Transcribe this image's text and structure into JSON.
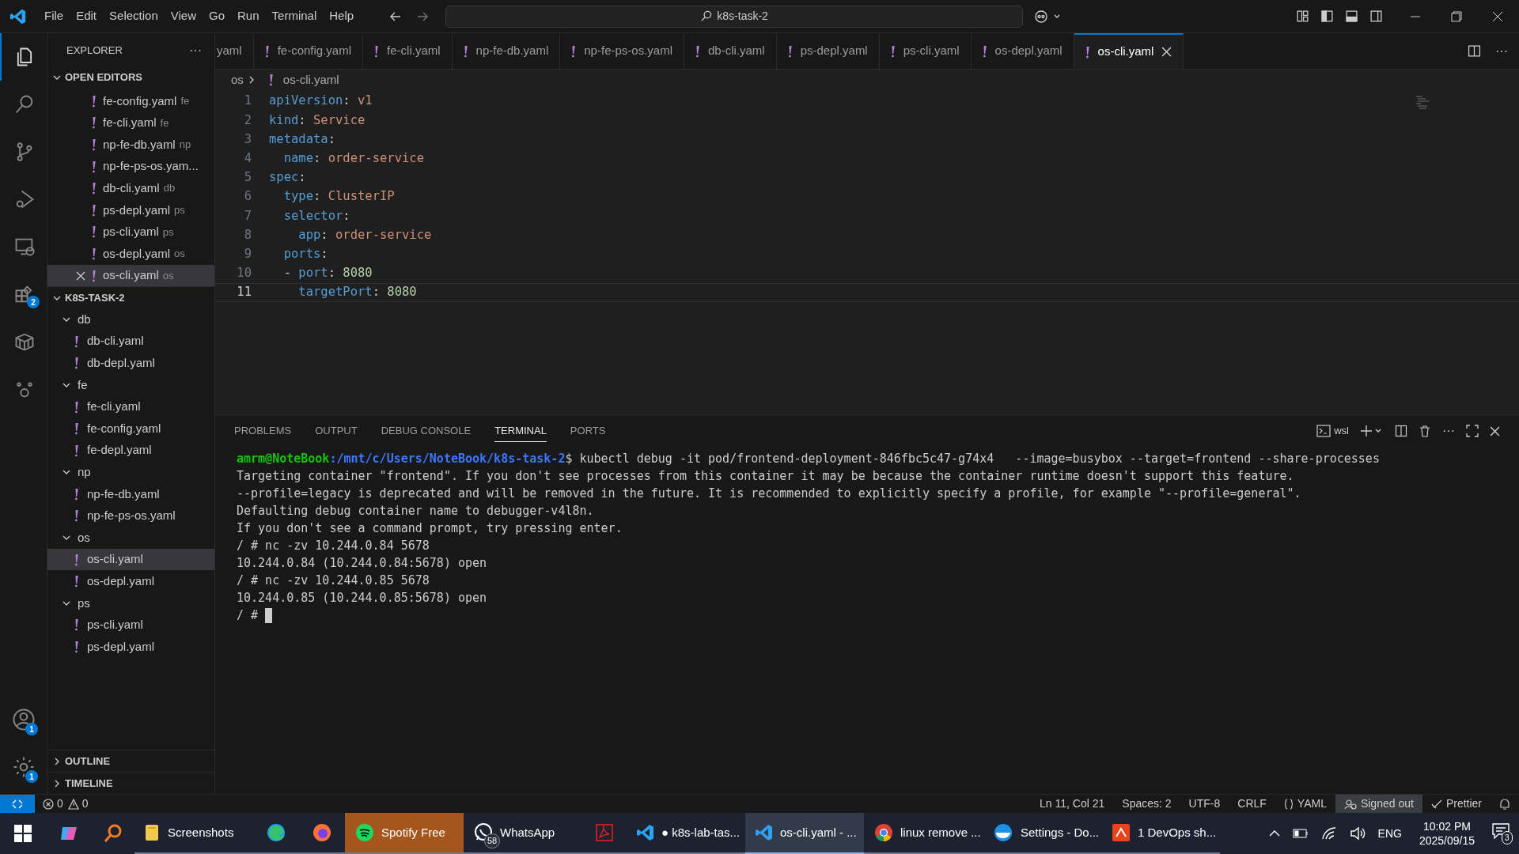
{
  "title_bar": {
    "menu": [
      "File",
      "Edit",
      "Selection",
      "View",
      "Go",
      "Run",
      "Terminal",
      "Help"
    ],
    "search": "k8s-task-2"
  },
  "activity_bar": [
    {
      "kind": "explorer",
      "selected": true
    },
    {
      "kind": "search",
      "selected": false
    },
    {
      "kind": "source-control",
      "selected": false
    },
    {
      "kind": "run",
      "selected": false
    },
    {
      "kind": "remote",
      "selected": false
    },
    {
      "kind": "extensions",
      "selected": false,
      "badge": "2"
    },
    {
      "kind": "containers",
      "selected": false
    },
    {
      "kind": "face",
      "selected": false
    }
  ],
  "activity_bottom": [
    {
      "kind": "account",
      "badge": "1"
    },
    {
      "kind": "settings",
      "badge": "1"
    }
  ],
  "sidebar": {
    "title": "EXPLORER",
    "more": "···",
    "open_editors": {
      "title": "OPEN EDITORS",
      "items": [
        {
          "name": "fe-config.yaml",
          "folder": "fe",
          "selected": false
        },
        {
          "name": "fe-cli.yaml",
          "folder": "fe",
          "selected": false
        },
        {
          "name": "np-fe-db.yaml",
          "folder": "np",
          "selected": false
        },
        {
          "name": "np-fe-ps-os.yam...",
          "selected": false
        },
        {
          "name": "db-cli.yaml",
          "folder": "db",
          "selected": false
        },
        {
          "name": "ps-depl.yaml",
          "folder": "ps",
          "selected": false
        },
        {
          "name": "ps-cli.yaml",
          "folder": "ps",
          "selected": false
        },
        {
          "name": "os-depl.yaml",
          "folder": "os",
          "selected": false
        },
        {
          "name": "os-cli.yaml",
          "folder": "os",
          "selected": true
        }
      ]
    },
    "project": {
      "title": "K8S-TASK-2",
      "tree": [
        {
          "name": "db",
          "expanded": true,
          "children": [
            {
              "name": "db-cli.yaml",
              "selected": false
            },
            {
              "name": "db-depl.yaml",
              "selected": false
            }
          ]
        },
        {
          "name": "fe",
          "expanded": true,
          "children": [
            {
              "name": "fe-cli.yaml",
              "selected": false
            },
            {
              "name": "fe-config.yaml",
              "selected": false
            },
            {
              "name": "fe-depl.yaml",
              "selected": false
            }
          ]
        },
        {
          "name": "np",
          "expanded": true,
          "children": [
            {
              "name": "np-fe-db.yaml",
              "selected": false
            },
            {
              "name": "np-fe-ps-os.yaml",
              "selected": false
            }
          ]
        },
        {
          "name": "os",
          "expanded": true,
          "children": [
            {
              "name": "os-cli.yaml",
              "selected": true
            },
            {
              "name": "os-depl.yaml",
              "selected": false
            }
          ]
        },
        {
          "name": "ps",
          "expanded": true,
          "children": [
            {
              "name": "ps-cli.yaml",
              "selected": false
            },
            {
              "name": "ps-depl.yaml",
              "selected": false
            }
          ]
        }
      ]
    },
    "sections": [
      {
        "title": "OUTLINE",
        "expanded": false
      },
      {
        "title": "TIMELINE",
        "expanded": false
      }
    ]
  },
  "tabs": [
    {
      "label": "yaml",
      "icon": false,
      "selected": false
    },
    {
      "label": "fe-config.yaml",
      "icon": true,
      "selected": false
    },
    {
      "label": "fe-cli.yaml",
      "icon": true,
      "selected": false
    },
    {
      "label": "np-fe-db.yaml",
      "icon": true,
      "selected": false
    },
    {
      "label": "np-fe-ps-os.yaml",
      "icon": true,
      "selected": false
    },
    {
      "label": "db-cli.yaml",
      "icon": true,
      "selected": false
    },
    {
      "label": "ps-depl.yaml",
      "icon": true,
      "selected": false
    },
    {
      "label": "ps-cli.yaml",
      "icon": true,
      "selected": false
    },
    {
      "label": "os-depl.yaml",
      "icon": true,
      "selected": false
    },
    {
      "label": "os-cli.yaml",
      "icon": true,
      "selected": true
    }
  ],
  "breadcrumb": {
    "folder": "os",
    "file": "os-cli.yaml"
  },
  "code": [
    {
      "number": "1",
      "current": false,
      "tokens": [
        {
          "text": "apiVersion",
          "kind": "key"
        },
        {
          "text": ": ",
          "kind": "punct"
        },
        {
          "text": "v1",
          "kind": "string"
        }
      ]
    },
    {
      "number": "2",
      "current": false,
      "tokens": [
        {
          "text": "kind",
          "kind": "key"
        },
        {
          "text": ": ",
          "kind": "punct"
        },
        {
          "text": "Service",
          "kind": "string"
        }
      ]
    },
    {
      "number": "3",
      "current": false,
      "tokens": [
        {
          "text": "metadata",
          "kind": "key"
        },
        {
          "text": ":",
          "kind": "punct"
        }
      ]
    },
    {
      "number": "4",
      "current": false,
      "tokens": [
        {
          "text": "  name",
          "kind": "key"
        },
        {
          "text": ": ",
          "kind": "punct"
        },
        {
          "text": "order-service",
          "kind": "string"
        }
      ]
    },
    {
      "number": "5",
      "current": false,
      "tokens": [
        {
          "text": "spec",
          "kind": "key"
        },
        {
          "text": ":",
          "kind": "punct"
        }
      ]
    },
    {
      "number": "6",
      "current": false,
      "tokens": [
        {
          "text": "  type",
          "kind": "key"
        },
        {
          "text": ": ",
          "kind": "punct"
        },
        {
          "text": "ClusterIP",
          "kind": "string"
        }
      ]
    },
    {
      "number": "7",
      "current": false,
      "tokens": [
        {
          "text": "  selector",
          "kind": "key"
        },
        {
          "text": ":",
          "kind": "punct"
        }
      ]
    },
    {
      "number": "8",
      "current": false,
      "tokens": [
        {
          "text": "    app",
          "kind": "key"
        },
        {
          "text": ": ",
          "kind": "punct"
        },
        {
          "text": "order-service",
          "kind": "string"
        }
      ]
    },
    {
      "number": "9",
      "current": false,
      "tokens": [
        {
          "text": "  ports",
          "kind": "key"
        },
        {
          "text": ":",
          "kind": "punct"
        }
      ]
    },
    {
      "number": "10",
      "current": false,
      "tokens": [
        {
          "text": "  - ",
          "kind": "punct"
        },
        {
          "text": "port",
          "kind": "key"
        },
        {
          "text": ": ",
          "kind": "punct"
        },
        {
          "text": "8080",
          "kind": "number"
        }
      ]
    },
    {
      "number": "11",
      "current": true,
      "tokens": [
        {
          "text": "    targetPort",
          "kind": "key"
        },
        {
          "text": ": ",
          "kind": "punct"
        },
        {
          "text": "8080",
          "kind": "number"
        }
      ]
    }
  ],
  "panel": {
    "tabs": [
      {
        "label": "PROBLEMS",
        "selected": false
      },
      {
        "label": "OUTPUT",
        "selected": false
      },
      {
        "label": "DEBUG CONSOLE",
        "selected": false
      },
      {
        "label": "TERMINAL",
        "selected": true
      },
      {
        "label": "PORTS",
        "selected": false
      }
    ],
    "shell": "wsl",
    "terminal": [
      {
        "kind": "prompt",
        "user": "amrm@NoteBook",
        "path": ":/mnt/c/Users/NoteBook/k8s-task-2",
        "command": "$ kubectl debug -it pod/frontend-deployment-846fbc5c47-g74x4   --image=busybox --target=frontend --share-processes"
      },
      {
        "kind": "output",
        "text": "Targeting container \"frontend\". If you don't see processes from this container it may be because the container runtime doesn't support this feature."
      },
      {
        "kind": "output",
        "text": "--profile=legacy is deprecated and will be removed in the future. It is recommended to explicitly specify a profile, for example \"--profile=general\"."
      },
      {
        "kind": "output",
        "text": "Defaulting debug container name to debugger-v4l8n."
      },
      {
        "kind": "output",
        "text": "If you don't see a command prompt, try pressing enter."
      },
      {
        "kind": "output",
        "text": "/ # nc -zv 10.244.0.84 5678"
      },
      {
        "kind": "output",
        "text": "10.244.0.84 (10.244.0.84:5678) open"
      },
      {
        "kind": "output",
        "text": "/ # nc -zv 10.244.0.85 5678"
      },
      {
        "kind": "output",
        "text": "10.244.0.85 (10.244.0.85:5678) open"
      },
      {
        "kind": "cursor",
        "text": "/ #"
      }
    ]
  },
  "status_bar": {
    "errors": "0",
    "warnings": "0",
    "items": [
      "Ln 11, Col 21",
      "Spaces: 2",
      "UTF-8",
      "CRLF",
      "YAML",
      "Signed out",
      "Prettier"
    ]
  },
  "taskbar": {
    "apps": [
      {
        "kind": "folder",
        "label": "Screenshots",
        "selected": false,
        "flashing": false
      },
      {
        "kind": "edge",
        "selected": false,
        "flashing": false
      },
      {
        "kind": "firefox",
        "selected": false,
        "flashing": false
      },
      {
        "kind": "spotify",
        "label": "Spotify Free",
        "selected": false,
        "flashing": true
      },
      {
        "kind": "whatsapp",
        "label": "WhatsApp",
        "badge": "58",
        "selected": false,
        "flashing": false
      },
      {
        "kind": "pdf",
        "selected": false,
        "flashing": false
      },
      {
        "kind": "vscode",
        "label": "● k8s-lab-tas...",
        "selected": false,
        "flashing": false
      },
      {
        "kind": "vscode",
        "label": "os-cli.yaml - ...",
        "selected": true,
        "flashing": false
      },
      {
        "kind": "chrome",
        "label": "linux remove ...",
        "selected": false,
        "flashing": false
      },
      {
        "kind": "docker",
        "label": "Settings - Do...",
        "selected": false,
        "flashing": false
      },
      {
        "kind": "reader",
        "label": "1 DevOps sh...",
        "selected": false,
        "flashing": false
      }
    ],
    "language": "ENG",
    "time": "10:02 PM",
    "date": "2025/09/15",
    "notifications": "3"
  }
}
